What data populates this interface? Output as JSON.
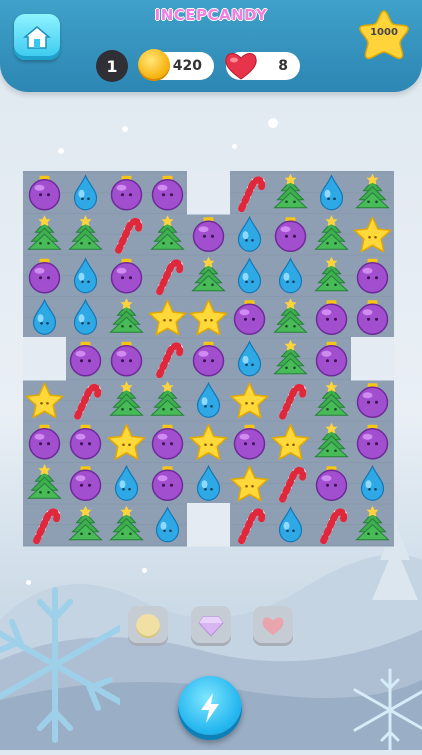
{
  "header": {
    "title": "INCEPCANDY",
    "level": "1",
    "coins": "420",
    "lives": "8",
    "score": "1000"
  },
  "icons": {
    "home": "home-icon",
    "coin": "coin-icon",
    "heart": "heart-icon",
    "star": "star-icon",
    "play": "lightning-icon"
  },
  "colors": {
    "header": "#3fa1c9",
    "board": "#8e9fb3",
    "title": "#f27fe0"
  },
  "board": {
    "columns": 9,
    "rows": 9,
    "cells": [
      [
        "ornament",
        "drop",
        "ornament",
        "ornament",
        "",
        "cane",
        "tree",
        "drop",
        "tree"
      ],
      [
        "tree",
        "tree",
        "cane",
        "tree",
        "ornament",
        "drop",
        "ornament",
        "tree",
        "star"
      ],
      [
        "ornament",
        "drop",
        "ornament",
        "cane",
        "tree",
        "drop",
        "drop",
        "tree",
        "ornament"
      ],
      [
        "drop",
        "drop",
        "tree",
        "star",
        "star",
        "ornament",
        "tree",
        "ornament",
        "ornament"
      ],
      [
        "",
        "ornament",
        "ornament",
        "cane",
        "ornament",
        "drop",
        "tree",
        "ornament",
        ""
      ],
      [
        "star",
        "cane",
        "tree",
        "tree",
        "drop",
        "star",
        "cane",
        "tree",
        "ornament"
      ],
      [
        "ornament",
        "ornament",
        "star",
        "ornament",
        "star",
        "ornament",
        "star",
        "tree",
        "ornament"
      ],
      [
        "tree",
        "ornament",
        "drop",
        "ornament",
        "drop",
        "star",
        "cane",
        "ornament",
        "drop"
      ],
      [
        "cane",
        "tree",
        "tree",
        "drop",
        "",
        "cane",
        "drop",
        "cane",
        "tree"
      ]
    ]
  },
  "boosters": [
    "coin-booster",
    "gem-booster",
    "heart-booster"
  ]
}
